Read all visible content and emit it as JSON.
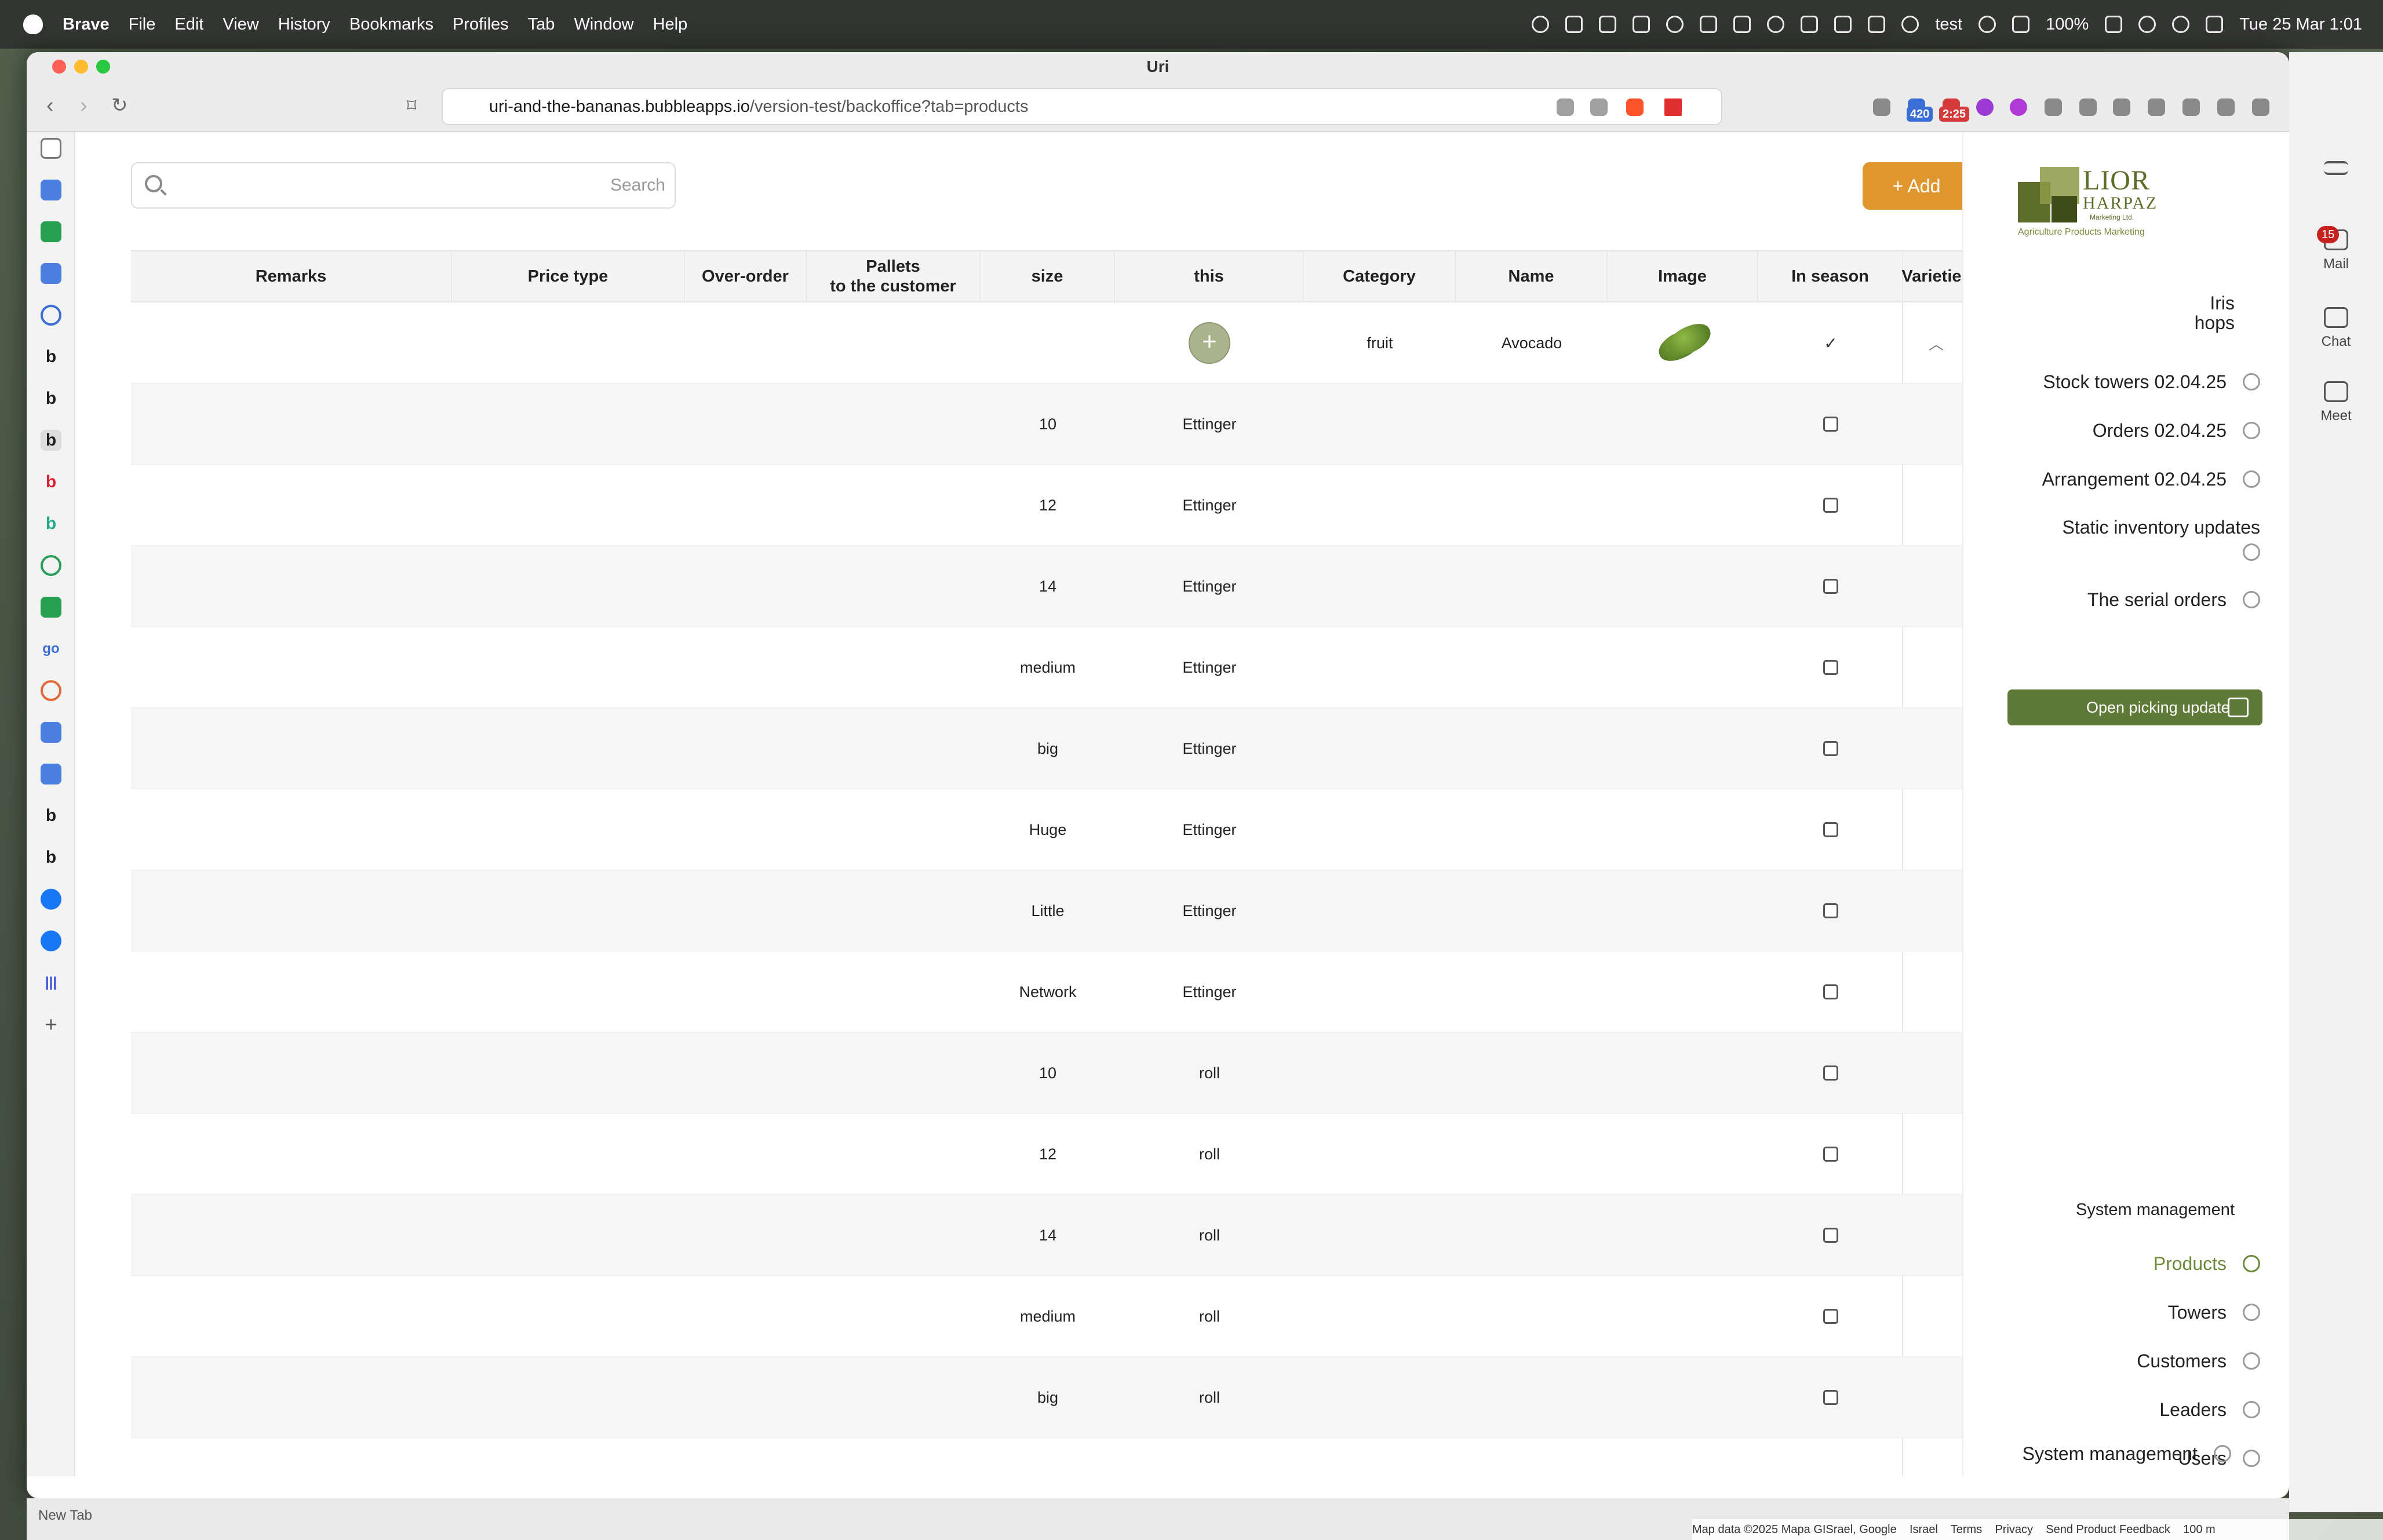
{
  "menubar": {
    "app": "Brave",
    "items": [
      "File",
      "Edit",
      "View",
      "History",
      "Bookmarks",
      "Profiles",
      "Tab",
      "Window",
      "Help"
    ],
    "status_user": "test",
    "battery": "100%",
    "datetime": "Tue 25 Mar  1:01"
  },
  "window": {
    "title": "Uri",
    "url_domain": "uri-and-the-bananas.bubbleapps.io",
    "url_path": "/version-test/backoffice?tab=products",
    "badge_1": "420",
    "badge_2": "2:25"
  },
  "toolbar": {
    "search_placeholder": "Search",
    "add_label": "+ Add"
  },
  "table": {
    "headers": {
      "remarks": "Remarks",
      "price_type": "Price type",
      "over_order": "Over-order",
      "pallets": "Pallets\nto the customer",
      "size": "size",
      "this": "this",
      "category": "Category",
      "name": "Name",
      "image": "Image",
      "in_season": "In season",
      "varieties": "Varieties"
    },
    "product": {
      "category": "fruit",
      "name": "Avocado"
    },
    "rows": [
      {
        "size": "10",
        "this": "Ettinger"
      },
      {
        "size": "12",
        "this": "Ettinger"
      },
      {
        "size": "14",
        "this": "Ettinger"
      },
      {
        "size": "medium",
        "this": "Ettinger"
      },
      {
        "size": "big",
        "this": "Ettinger"
      },
      {
        "size": "Huge",
        "this": "Ettinger"
      },
      {
        "size": "Little",
        "this": "Ettinger"
      },
      {
        "size": "Network",
        "this": "Ettinger"
      },
      {
        "size": "10",
        "this": "roll"
      },
      {
        "size": "12",
        "this": "roll"
      },
      {
        "size": "14",
        "this": "roll"
      },
      {
        "size": "medium",
        "this": "roll"
      },
      {
        "size": "big",
        "this": "roll"
      }
    ]
  },
  "panel": {
    "logo_line1": "LIOR",
    "logo_line2": "HARPAZ",
    "logo_line3": "Marketing Ltd.",
    "logo_tagline": "Agriculture Products Marketing",
    "user_first": "Iris",
    "user_last": "hops",
    "links": {
      "stock": "Stock towers 02.04.25",
      "orders": "Orders 02.04.25",
      "arrangement": "Arrangement 02.04.25",
      "static": "Static inventory updates",
      "serial": "The serial orders",
      "picking": "Open picking update"
    },
    "system_header": "System management",
    "sys": {
      "products": "Products",
      "towers": "Towers",
      "customers": "Customers",
      "leaders": "Leaders",
      "users": "Users",
      "system": "System management"
    }
  },
  "right_sidebar": {
    "mail": "Mail",
    "mail_count": "15",
    "chat": "Chat",
    "meet": "Meet"
  },
  "bottom": {
    "new_tab": "New Tab",
    "map_attr": "Map data ©2025 Mapa GISrael, Google",
    "israel": "Israel",
    "terms": "Terms",
    "privacy": "Privacy",
    "feedback": "Send Product Feedback",
    "scale": "100 m"
  }
}
